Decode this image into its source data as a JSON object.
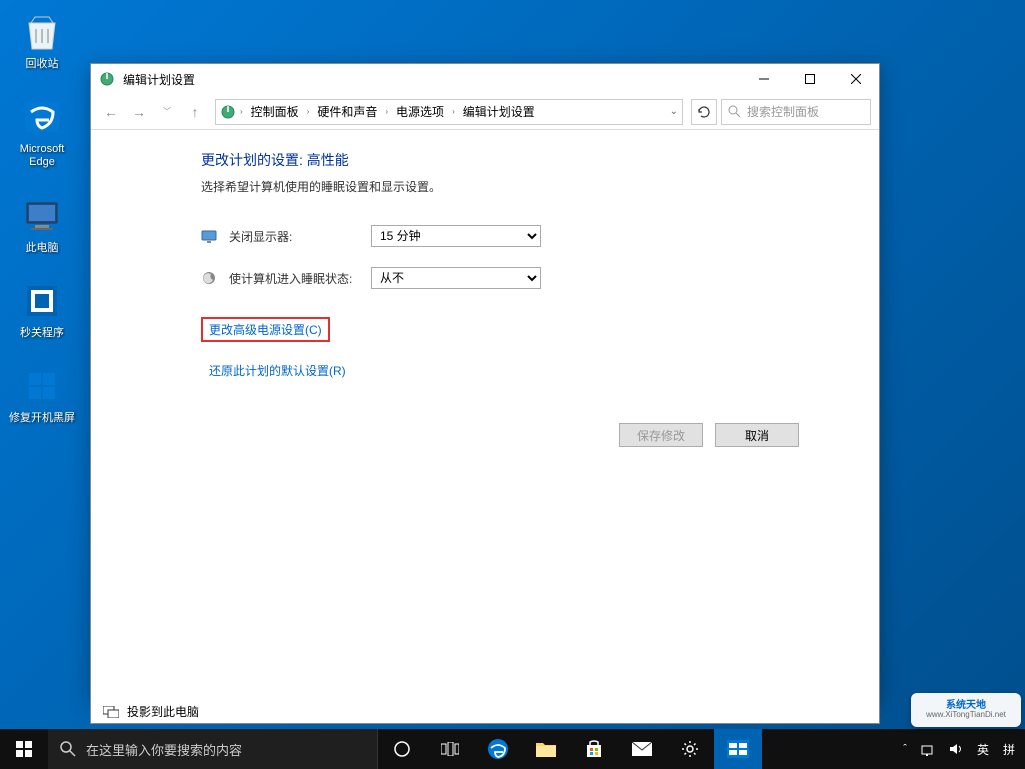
{
  "desktop": {
    "icons": [
      {
        "name": "recycle-bin",
        "label": "回收站"
      },
      {
        "name": "edge",
        "label": "Microsoft Edge"
      },
      {
        "name": "this-pc",
        "label": "此电脑"
      },
      {
        "name": "shutdown-tool",
        "label": "秒关程序"
      },
      {
        "name": "fix-boot",
        "label": "修复开机黑屏"
      }
    ]
  },
  "window": {
    "title": "编辑计划设置",
    "breadcrumbs": [
      "控制面板",
      "硬件和声音",
      "电源选项",
      "编辑计划设置"
    ],
    "search_placeholder": "搜索控制面板",
    "heading": "更改计划的设置: 高性能",
    "description": "选择希望计算机使用的睡眠设置和显示设置。",
    "setting1_label": "关闭显示器:",
    "setting1_value": "15 分钟",
    "setting2_label": "使计算机进入睡眠状态:",
    "setting2_value": "从不",
    "link_advanced": "更改高级电源设置(C)",
    "link_restore": "还原此计划的默认设置(R)",
    "btn_save": "保存修改",
    "btn_cancel": "取消",
    "project_notice": "投影到此电脑"
  },
  "taskbar": {
    "search_placeholder": "在这里输入你要搜索的内容",
    "ime_lang": "英",
    "ime_mode": "拼"
  },
  "watermark": {
    "main": "系统天地",
    "sub": "www.XiTongTianDi.net"
  }
}
